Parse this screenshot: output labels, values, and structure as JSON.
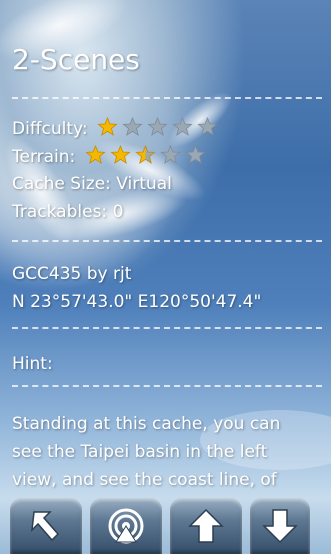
{
  "title": "2-Scenes",
  "difficulty": {
    "label": "Diffculty:",
    "rating": 1,
    "max": 5
  },
  "terrain": {
    "label": "Terrain:",
    "rating": 2.5,
    "max": 5
  },
  "cache_size": "Cache Size: Virtual",
  "trackables": "Trackables: 0",
  "cache_id": "GCC435 by rjt",
  "coordinates": "N 23°57'43.0\" E120°50'47.4\"",
  "hint_label": "Hint:",
  "description_lines": [
    "Standing at this cache, you can",
    "see the Taipei basin in the left",
    "view, and see the coast line, of"
  ],
  "toolbar": {
    "icons": [
      "back-arrow-icon",
      "broadcast-icon",
      "up-arrow-icon",
      "down-arrow-icon"
    ]
  },
  "colors": {
    "star_filled": "#f5b800",
    "star_empty": "#9aa7b4"
  }
}
